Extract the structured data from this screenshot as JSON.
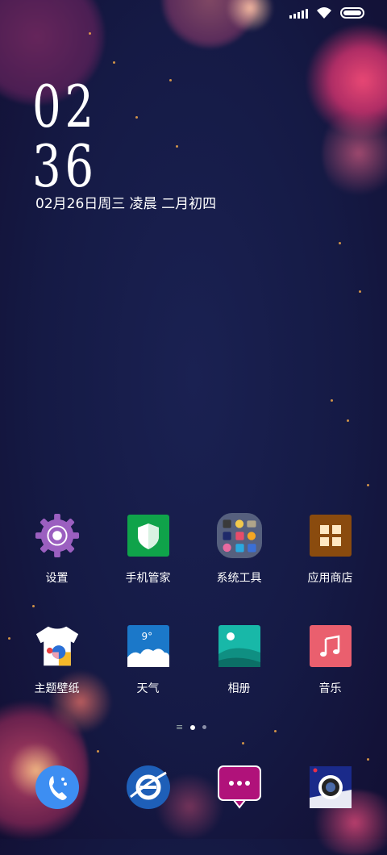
{
  "clock": {
    "hour": "02",
    "minute": "36"
  },
  "date_line": "02月26日周三 凌晨 二月初四",
  "apps_row1": [
    {
      "label": "设置",
      "icon": "gear-icon"
    },
    {
      "label": "手机管家",
      "icon": "shield-icon"
    },
    {
      "label": "系统工具",
      "icon": "folder-icon"
    },
    {
      "label": "应用商店",
      "icon": "store-icon"
    }
  ],
  "apps_row2": [
    {
      "label": "主题壁纸",
      "icon": "tshirt-icon"
    },
    {
      "label": "天气",
      "icon": "weather-icon"
    },
    {
      "label": "相册",
      "icon": "gallery-icon"
    },
    {
      "label": "音乐",
      "icon": "music-icon"
    }
  ],
  "weather_temp": "9°",
  "dock": [
    {
      "icon": "phone-icon"
    },
    {
      "icon": "browser-icon"
    },
    {
      "icon": "messages-icon"
    },
    {
      "icon": "camera-icon"
    }
  ],
  "page_indicator": {
    "pages": 2,
    "current": 1
  },
  "colors": {
    "background": "#151a45",
    "bokeh_pink": "#e0406a",
    "bokeh_orange": "#ffb24a"
  }
}
